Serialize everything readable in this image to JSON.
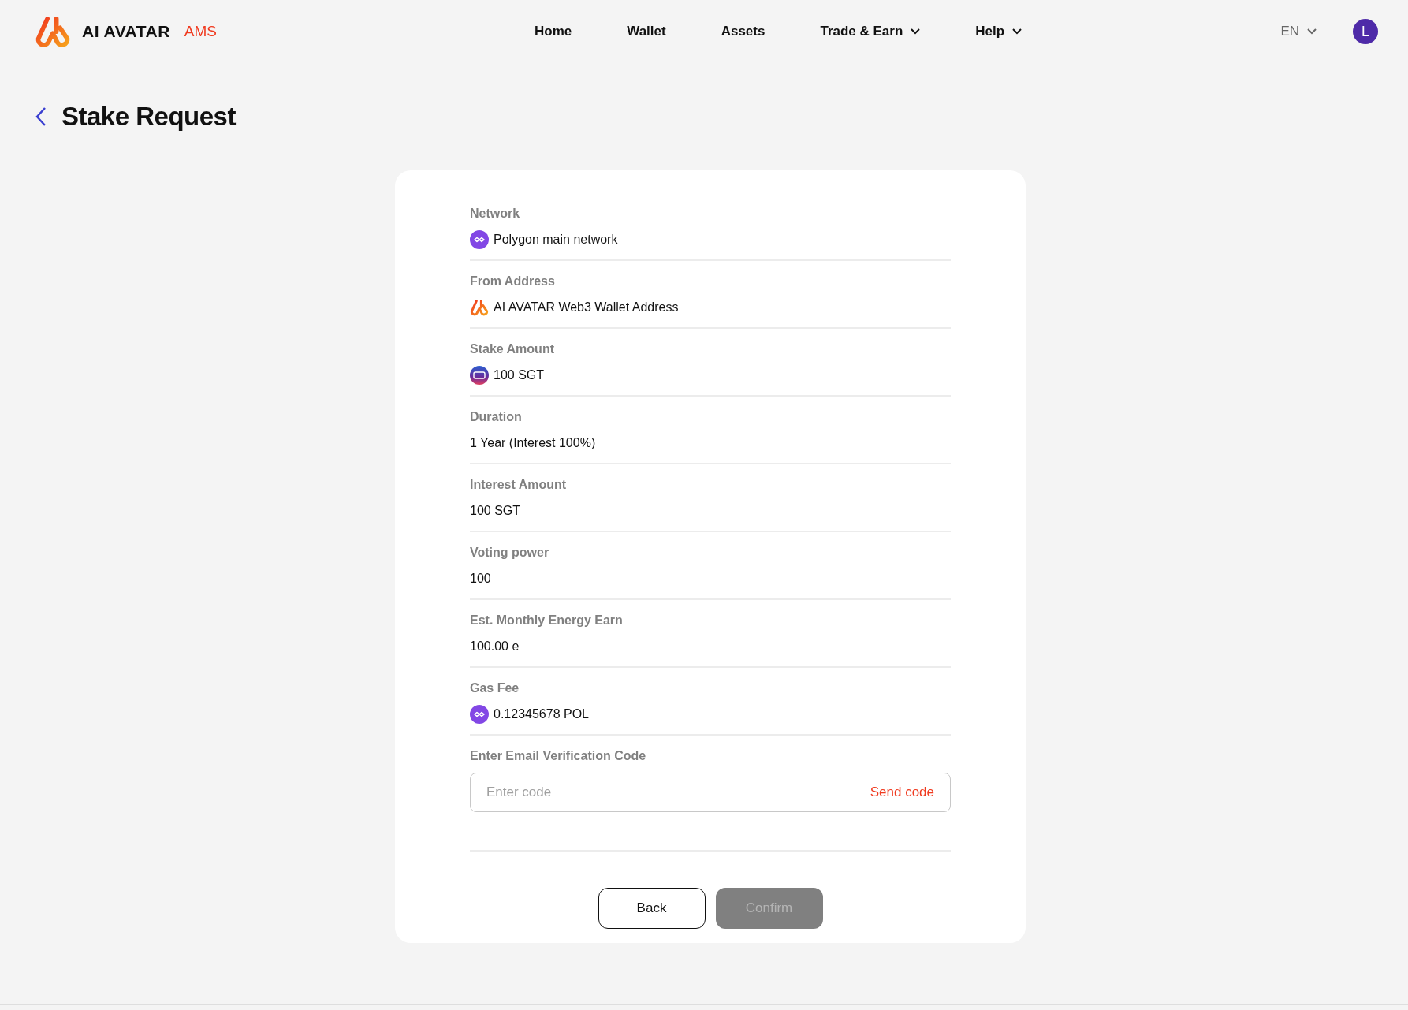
{
  "header": {
    "brand": "AI AVATAR",
    "brand_tag": "AMS",
    "nav": [
      {
        "label": "Home",
        "dropdown": false
      },
      {
        "label": "Wallet",
        "dropdown": false
      },
      {
        "label": "Assets",
        "dropdown": false
      },
      {
        "label": "Trade & Earn",
        "dropdown": true
      },
      {
        "label": "Help",
        "dropdown": true
      }
    ],
    "language": "EN",
    "avatar_initial": "L"
  },
  "page_title": "Stake Request",
  "fields": [
    {
      "label": "Network",
      "value": "Polygon main network",
      "kind": "chain"
    },
    {
      "label": "From Address",
      "value": "AI AVATAR Web3 Wallet Address",
      "kind": "wallet"
    },
    {
      "label": "Stake Amount",
      "value": "100 SGT",
      "kind": "token"
    },
    {
      "label": "Duration",
      "value": "1 Year (Interest 100%)",
      "kind": "plain"
    },
    {
      "label": "Interest Amount",
      "value": "100 SGT",
      "kind": "plain"
    },
    {
      "label": "Voting power",
      "value": "100",
      "kind": "plain"
    },
    {
      "label": "Est. Monthly Energy Earn",
      "value": "100.00 e",
      "kind": "plain"
    },
    {
      "label": "Gas Fee",
      "value": "0.12345678 POL",
      "kind": "chain"
    }
  ],
  "verification": {
    "label": "Enter Email Verification Code",
    "placeholder": "Enter code",
    "send_label": "Send code"
  },
  "buttons": {
    "back": "Back",
    "confirm": "Confirm",
    "confirm_disabled": true
  }
}
